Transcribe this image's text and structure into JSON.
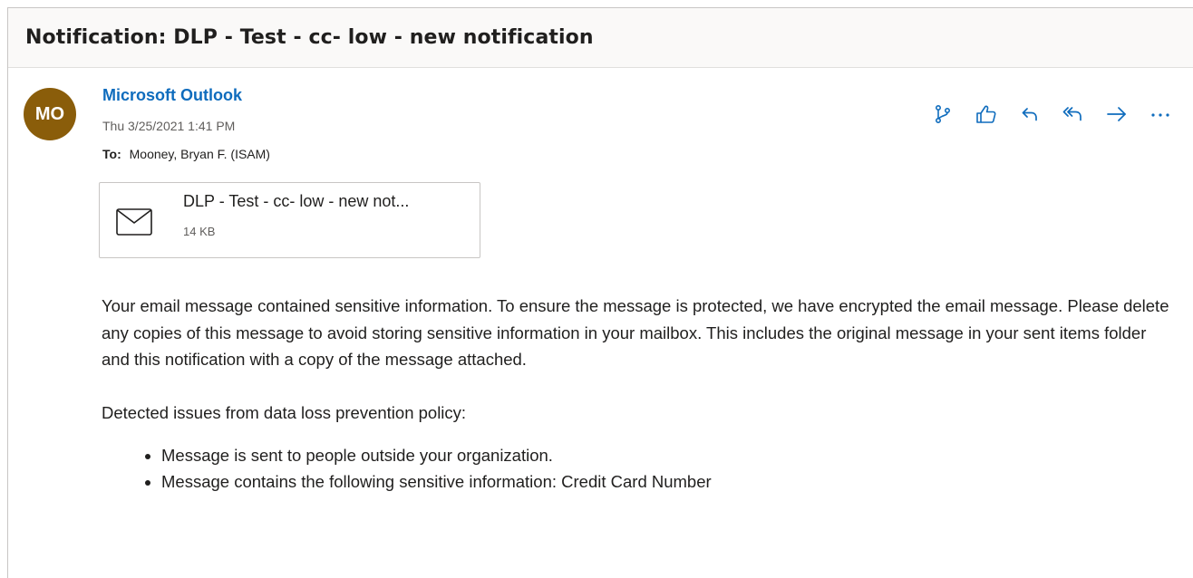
{
  "subject": "Notification: DLP - Test - cc- low - new notification",
  "sender": {
    "initials": "MO",
    "avatar_color": "#8a5d0a",
    "name": "Microsoft Outlook",
    "date": "Thu 3/25/2021 1:41 PM",
    "to_label": "To:",
    "to_value": "Mooney, Bryan F. (ISAM)"
  },
  "actions": [
    {
      "name": "loop-icon"
    },
    {
      "name": "like-icon"
    },
    {
      "name": "reply-icon"
    },
    {
      "name": "reply-all-icon"
    },
    {
      "name": "forward-icon"
    },
    {
      "name": "more-options-icon"
    }
  ],
  "attachment": {
    "icon": "envelope-icon",
    "name": "DLP - Test - cc- low - new not...",
    "size": "14 KB"
  },
  "body": {
    "paragraph1": "Your email message contained sensitive information. To ensure the message is protected, we have encrypted the email message. Please delete any copies of this message to avoid storing sensitive information in your mailbox. This includes the original message in your sent items folder and this notification with a copy of the message attached.",
    "paragraph2": "Detected issues from data loss prevention policy:",
    "issues": [
      "Message is sent to people outside your organization.",
      "Message contains the following sensitive information: Credit Card Number"
    ]
  },
  "colors": {
    "accent": "#0f6cbd",
    "subject_bar": "#faf9f8"
  }
}
